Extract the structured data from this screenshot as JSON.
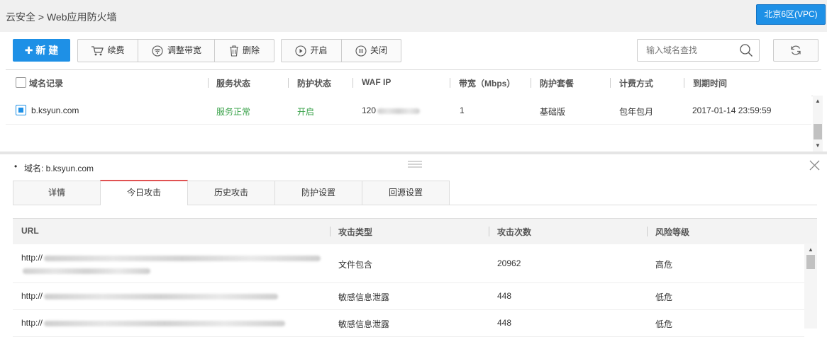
{
  "header": {
    "breadcrumb": "云安全 > Web应用防火墙",
    "region": "北京6区(VPC)"
  },
  "toolbar": {
    "new_label": "新 建",
    "renew_label": "续费",
    "adjust_label": "调整带宽",
    "delete_label": "删除",
    "open_label": "开启",
    "close_label": "关闭",
    "search_placeholder": "输入域名查找"
  },
  "table": {
    "headers": [
      "域名记录",
      "服务状态",
      "防护状态",
      "WAF IP",
      "带宽（Mbps）",
      "防护套餐",
      "计费方式",
      "到期时间"
    ],
    "rows": [
      {
        "domain": "b.ksyun.com",
        "service_status": "服务正常",
        "protect_status": "开启",
        "waf_ip": "120",
        "bandwidth": "1",
        "package": "基础版",
        "billing": "包年包月",
        "expire": "2017-01-14 23:59:59"
      }
    ]
  },
  "detail": {
    "domain_label": "域名: b.ksyun.com",
    "tabs": [
      "详情",
      "今日攻击",
      "历史攻击",
      "防护设置",
      "回源设置"
    ],
    "active_tab": 1,
    "attack_headers": [
      "URL",
      "攻击类型",
      "攻击次数",
      "风险等级"
    ],
    "attacks": [
      {
        "url": "http://",
        "type": "文件包含",
        "count": "20962",
        "risk": "高危"
      },
      {
        "url": "http://",
        "type": "敏感信息泄露",
        "count": "448",
        "risk": "低危"
      },
      {
        "url": "http://",
        "type": "敏感信息泄露",
        "count": "448",
        "risk": "低危"
      }
    ]
  },
  "colors": {
    "primary": "#1e90e6",
    "success": "#3aa24a",
    "active_tab": "#e05252"
  }
}
